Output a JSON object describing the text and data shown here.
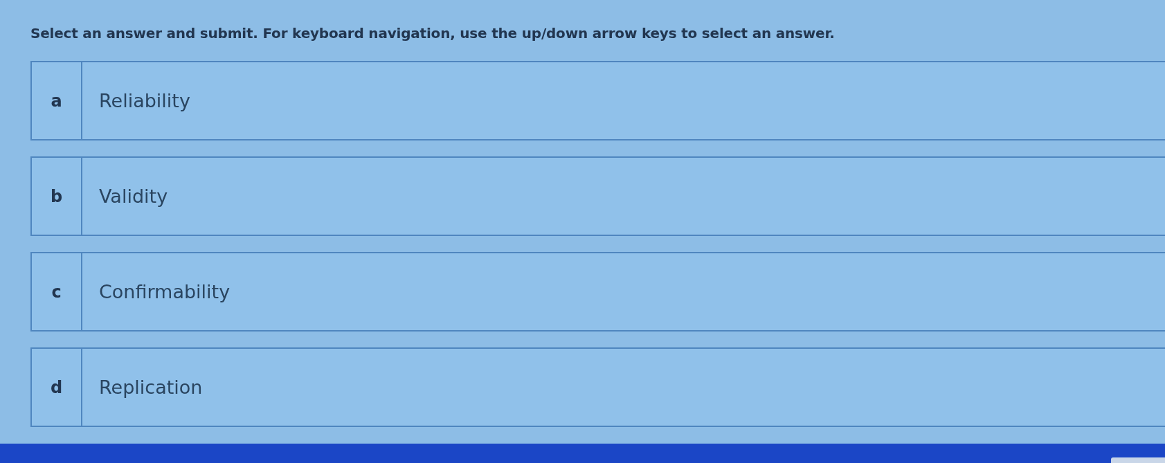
{
  "instruction": "Select an answer and submit. For keyboard navigation, use the up/down arrow keys to select an answer.",
  "options": [
    {
      "letter": "a",
      "text": "Reliability",
      "selected": false
    },
    {
      "letter": "b",
      "text": "Validity",
      "selected": false
    },
    {
      "letter": "c",
      "text": "Confirmability",
      "selected": false
    },
    {
      "letter": "d",
      "text": "Replication",
      "selected": false
    }
  ]
}
